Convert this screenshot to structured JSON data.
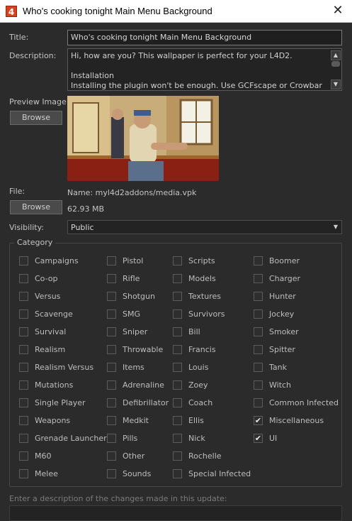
{
  "window": {
    "icon_glyph": "4",
    "title": "Who's cooking tonight  Main Menu Background",
    "close_glyph": "✕"
  },
  "form": {
    "title_label": "Title:",
    "title_value": "Who's cooking tonight  Main Menu Background",
    "description_label": "Description:",
    "description_text": "Hi, how are you? This wallpaper is perfect for your L4D2.\n\nInstallation\nInstalling the plugin won't be enough. Use GCFscape or Crowbar to open",
    "preview_label": "Preview Image:",
    "browse_label": "Browse",
    "file_label": "File:",
    "file_name": "Name:  myl4d2addons/media.vpk",
    "file_size": "62.93 MB",
    "browse2_label": "Browse",
    "visibility_label": "Visibility:",
    "visibility_value": "Public",
    "changes_placeholder": "Enter a description of the changes made in this update:"
  },
  "icons": {
    "scroll_up": "▲",
    "scroll_down": "▼",
    "dropdown": "▼",
    "check": "✔"
  },
  "category": {
    "label": "Category",
    "columns": [
      [
        {
          "label": "Campaigns",
          "checked": false
        },
        {
          "label": "Co-op",
          "checked": false
        },
        {
          "label": "Versus",
          "checked": false
        },
        {
          "label": "Scavenge",
          "checked": false
        },
        {
          "label": "Survival",
          "checked": false
        },
        {
          "label": "Realism",
          "checked": false
        },
        {
          "label": "Realism Versus",
          "checked": false
        },
        {
          "label": "Mutations",
          "checked": false
        },
        {
          "label": "Single Player",
          "checked": false
        },
        {
          "label": "Weapons",
          "checked": false
        },
        {
          "label": "Grenade Launcher",
          "checked": false
        },
        {
          "label": "M60",
          "checked": false
        },
        {
          "label": "Melee",
          "checked": false
        }
      ],
      [
        {
          "label": "Pistol",
          "checked": false
        },
        {
          "label": "Rifle",
          "checked": false
        },
        {
          "label": "Shotgun",
          "checked": false
        },
        {
          "label": "SMG",
          "checked": false
        },
        {
          "label": "Sniper",
          "checked": false
        },
        {
          "label": "Throwable",
          "checked": false
        },
        {
          "label": "Items",
          "checked": false
        },
        {
          "label": "Adrenaline",
          "checked": false
        },
        {
          "label": "Defibrillator",
          "checked": false
        },
        {
          "label": "Medkit",
          "checked": false
        },
        {
          "label": "Pills",
          "checked": false
        },
        {
          "label": "Other",
          "checked": false
        },
        {
          "label": "Sounds",
          "checked": false
        }
      ],
      [
        {
          "label": "Scripts",
          "checked": false
        },
        {
          "label": "Models",
          "checked": false
        },
        {
          "label": "Textures",
          "checked": false
        },
        {
          "label": "Survivors",
          "checked": false
        },
        {
          "label": "Bill",
          "checked": false
        },
        {
          "label": "Francis",
          "checked": false
        },
        {
          "label": "Louis",
          "checked": false
        },
        {
          "label": "Zoey",
          "checked": false
        },
        {
          "label": "Coach",
          "checked": false
        },
        {
          "label": "Ellis",
          "checked": false
        },
        {
          "label": "Nick",
          "checked": false
        },
        {
          "label": "Rochelle",
          "checked": false
        },
        {
          "label": "Special Infected",
          "checked": false
        }
      ],
      [
        {
          "label": "Boomer",
          "checked": false
        },
        {
          "label": "Charger",
          "checked": false
        },
        {
          "label": "Hunter",
          "checked": false
        },
        {
          "label": "Jockey",
          "checked": false
        },
        {
          "label": "Smoker",
          "checked": false
        },
        {
          "label": "Spitter",
          "checked": false
        },
        {
          "label": "Tank",
          "checked": false
        },
        {
          "label": "Witch",
          "checked": false
        },
        {
          "label": "Common Infected",
          "checked": false
        },
        {
          "label": "Miscellaneous",
          "checked": true
        },
        {
          "label": "UI",
          "checked": true
        }
      ]
    ]
  }
}
